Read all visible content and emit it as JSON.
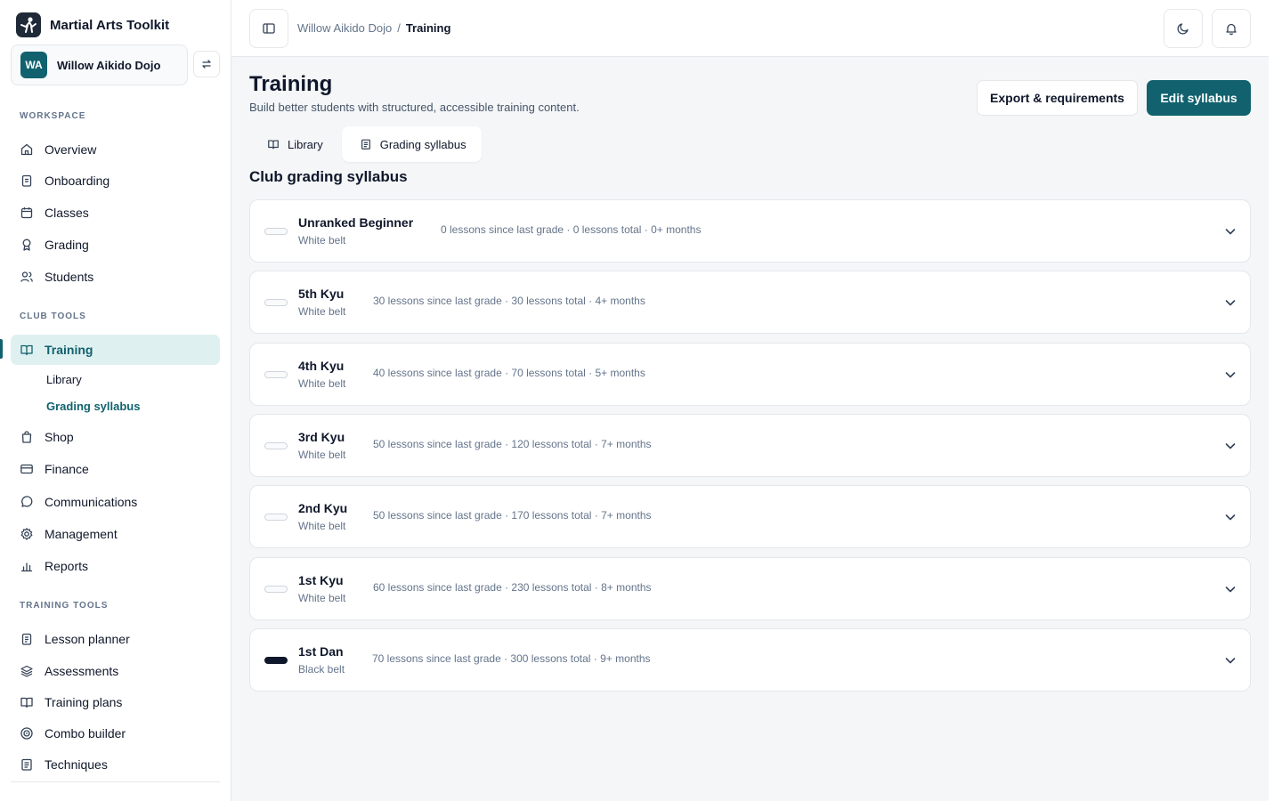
{
  "app": {
    "name": "Martial Arts Toolkit"
  },
  "org": {
    "initials": "WA",
    "name": "Willow Aikido Dojo"
  },
  "sidebar": {
    "sections": {
      "workspace": "WORKSPACE",
      "club_tools": "CLUB TOOLS",
      "training_tools": "TRAINING TOOLS"
    },
    "workspace_items": [
      {
        "label": "Overview",
        "icon": "home-icon"
      },
      {
        "label": "Onboarding",
        "icon": "clipboard-icon"
      },
      {
        "label": "Classes",
        "icon": "calendar-icon"
      },
      {
        "label": "Grading",
        "icon": "award-icon"
      },
      {
        "label": "Students",
        "icon": "users-icon"
      }
    ],
    "club_items": [
      {
        "label": "Training",
        "icon": "book-open-icon"
      },
      {
        "label": "Shop",
        "icon": "shopping-bag-icon"
      },
      {
        "label": "Finance",
        "icon": "credit-card-icon"
      },
      {
        "label": "Communications",
        "icon": "message-circle-icon"
      },
      {
        "label": "Management",
        "icon": "gear-icon"
      },
      {
        "label": "Reports",
        "icon": "bar-chart-icon"
      }
    ],
    "training_sub": [
      "Library",
      "Grading syllabus"
    ],
    "training_items": [
      {
        "label": "Lesson planner",
        "icon": "clipboard-list-icon"
      },
      {
        "label": "Assessments",
        "icon": "layers-icon"
      },
      {
        "label": "Training plans",
        "icon": "book-icon"
      },
      {
        "label": "Combo builder",
        "icon": "target-icon"
      },
      {
        "label": "Techniques",
        "icon": "file-text-icon"
      }
    ]
  },
  "header": {
    "breadcrumb": [
      "Willow Aikido Dojo",
      "/",
      "Training"
    ],
    "icons": [
      "sidebar-toggle-icon",
      "moon-icon",
      "bell-icon"
    ]
  },
  "page": {
    "title": "Training",
    "subtitle": "Build better students with structured, accessible training content.",
    "export_label": "Export & requirements",
    "edit_label": "Edit syllabus",
    "tabs": [
      "Library",
      "Grading syllabus"
    ],
    "section_title": "Club grading syllabus"
  },
  "colors": {
    "accent": "#11626e",
    "black_belt": "#0f172a",
    "white_belt": "#f8fafc"
  },
  "grades": [
    {
      "name": "Unranked Beginner",
      "belt": "White belt",
      "requirements": "0 lessons since last grade · 0 lessons total · 0+ months",
      "belt_color": "white"
    },
    {
      "name": "5th Kyu",
      "belt": "White belt",
      "requirements": "30 lessons since last grade · 30 lessons total · 4+ months",
      "belt_color": "white"
    },
    {
      "name": "4th Kyu",
      "belt": "White belt",
      "requirements": "40 lessons since last grade · 70 lessons total · 5+ months",
      "belt_color": "white"
    },
    {
      "name": "3rd Kyu",
      "belt": "White belt",
      "requirements": "50 lessons since last grade · 120 lessons total · 7+ months",
      "belt_color": "white"
    },
    {
      "name": "2nd Kyu",
      "belt": "White belt",
      "requirements": "50 lessons since last grade · 170 lessons total · 7+ months",
      "belt_color": "white"
    },
    {
      "name": "1st Kyu",
      "belt": "White belt",
      "requirements": "60 lessons since last grade · 230 lessons total · 8+ months",
      "belt_color": "white"
    },
    {
      "name": "1st Dan",
      "belt": "Black belt",
      "requirements": "70 lessons since last grade · 300 lessons total · 9+ months",
      "belt_color": "black"
    }
  ]
}
